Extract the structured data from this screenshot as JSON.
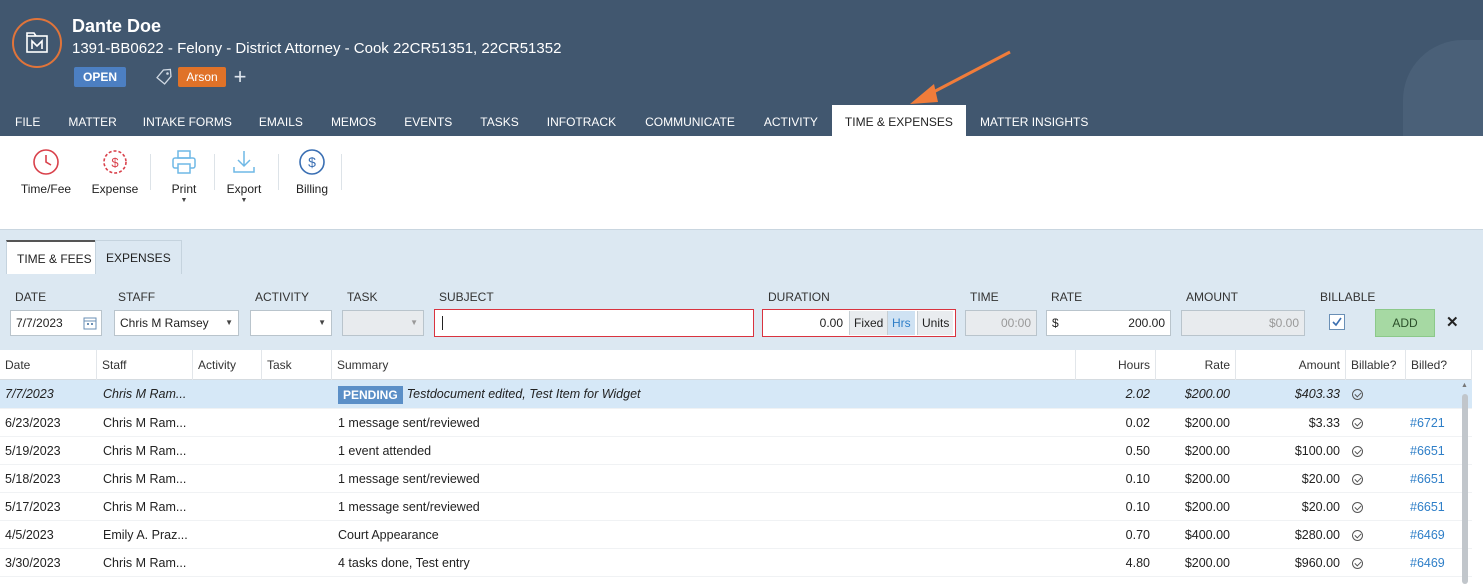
{
  "header": {
    "client_name": "Dante Doe",
    "matter_line": "1391-BB0622 - Felony - District Attorney - Cook 22CR51351, 22CR51352",
    "status_badge": "OPEN",
    "tag_label": "Arson",
    "colors": {
      "header_bg": "#41576f",
      "open_badge": "#4c7fc2",
      "tag_badge": "#e07228",
      "arrow": "#f07c3a"
    }
  },
  "tabs": [
    "FILE",
    "MATTER",
    "INTAKE FORMS",
    "EMAILS",
    "MEMOS",
    "EVENTS",
    "TASKS",
    "INFOTRACK",
    "COMMUNICATE",
    "ACTIVITY",
    "TIME & EXPENSES",
    "MATTER INSIGHTS"
  ],
  "active_tab": "TIME & EXPENSES",
  "ribbon": {
    "time_fee": "Time/Fee",
    "expense": "Expense",
    "print": "Print",
    "export": "Export",
    "billing": "Billing"
  },
  "subtabs": {
    "time_fees": "TIME & FEES",
    "expenses": "EXPENSES"
  },
  "form": {
    "date_label": "DATE",
    "date_value": "7/7/2023",
    "staff_label": "STAFF",
    "staff_value": "Chris M Ramsey",
    "activity_label": "ACTIVITY",
    "activity_value": "",
    "task_label": "TASK",
    "task_value": "",
    "subject_label": "SUBJECT",
    "subject_value": "",
    "duration_label": "DURATION",
    "duration_value": "0.00",
    "duration_fixed": "Fixed",
    "duration_hrs": "Hrs",
    "duration_units": "Units",
    "time_label": "TIME",
    "time_value": "00:00",
    "rate_label": "RATE",
    "rate_currency": "$",
    "rate_value": "200.00",
    "amount_label": "AMOUNT",
    "amount_value": "$0.00",
    "billable_label": "BILLABLE",
    "billable_checked": true,
    "add_label": "ADD",
    "close_label": "✕"
  },
  "grid": {
    "headers": {
      "date": "Date",
      "staff": "Staff",
      "activity": "Activity",
      "task": "Task",
      "summary": "Summary",
      "hours": "Hours",
      "rate": "Rate",
      "amount": "Amount",
      "billable": "Billable?",
      "billed": "Billed?"
    },
    "selected_row": {
      "date": "7/7/2023",
      "staff": "Chris M Ram...",
      "pending": "PENDING",
      "summary": "Testdocument edited, Test Item for Widget",
      "hours": "2.02",
      "rate": "$200.00",
      "amount": "$403.33",
      "billed": ""
    },
    "rows": [
      {
        "date": "6/23/2023",
        "staff": "Chris M Ram...",
        "summary": "1 message sent/reviewed",
        "hours": "0.02",
        "rate": "$200.00",
        "amount": "$3.33",
        "billed": "#6721"
      },
      {
        "date": "5/19/2023",
        "staff": "Chris M Ram...",
        "summary": "1 event attended",
        "hours": "0.50",
        "rate": "$200.00",
        "amount": "$100.00",
        "billed": "#6651"
      },
      {
        "date": "5/18/2023",
        "staff": "Chris M Ram...",
        "summary": "1 message sent/reviewed",
        "hours": "0.10",
        "rate": "$200.00",
        "amount": "$20.00",
        "billed": "#6651"
      },
      {
        "date": "5/17/2023",
        "staff": "Chris M Ram...",
        "summary": "1 message sent/reviewed",
        "hours": "0.10",
        "rate": "$200.00",
        "amount": "$20.00",
        "billed": "#6651"
      },
      {
        "date": "4/5/2023",
        "staff": "Emily A. Praz...",
        "summary": "Court Appearance",
        "hours": "0.70",
        "rate": "$400.00",
        "amount": "$280.00",
        "billed": "#6469"
      },
      {
        "date": "3/30/2023",
        "staff": "Chris M Ram...",
        "summary": "4 tasks done, Test entry",
        "hours": "4.80",
        "rate": "$200.00",
        "amount": "$960.00",
        "billed": "#6469"
      }
    ]
  }
}
